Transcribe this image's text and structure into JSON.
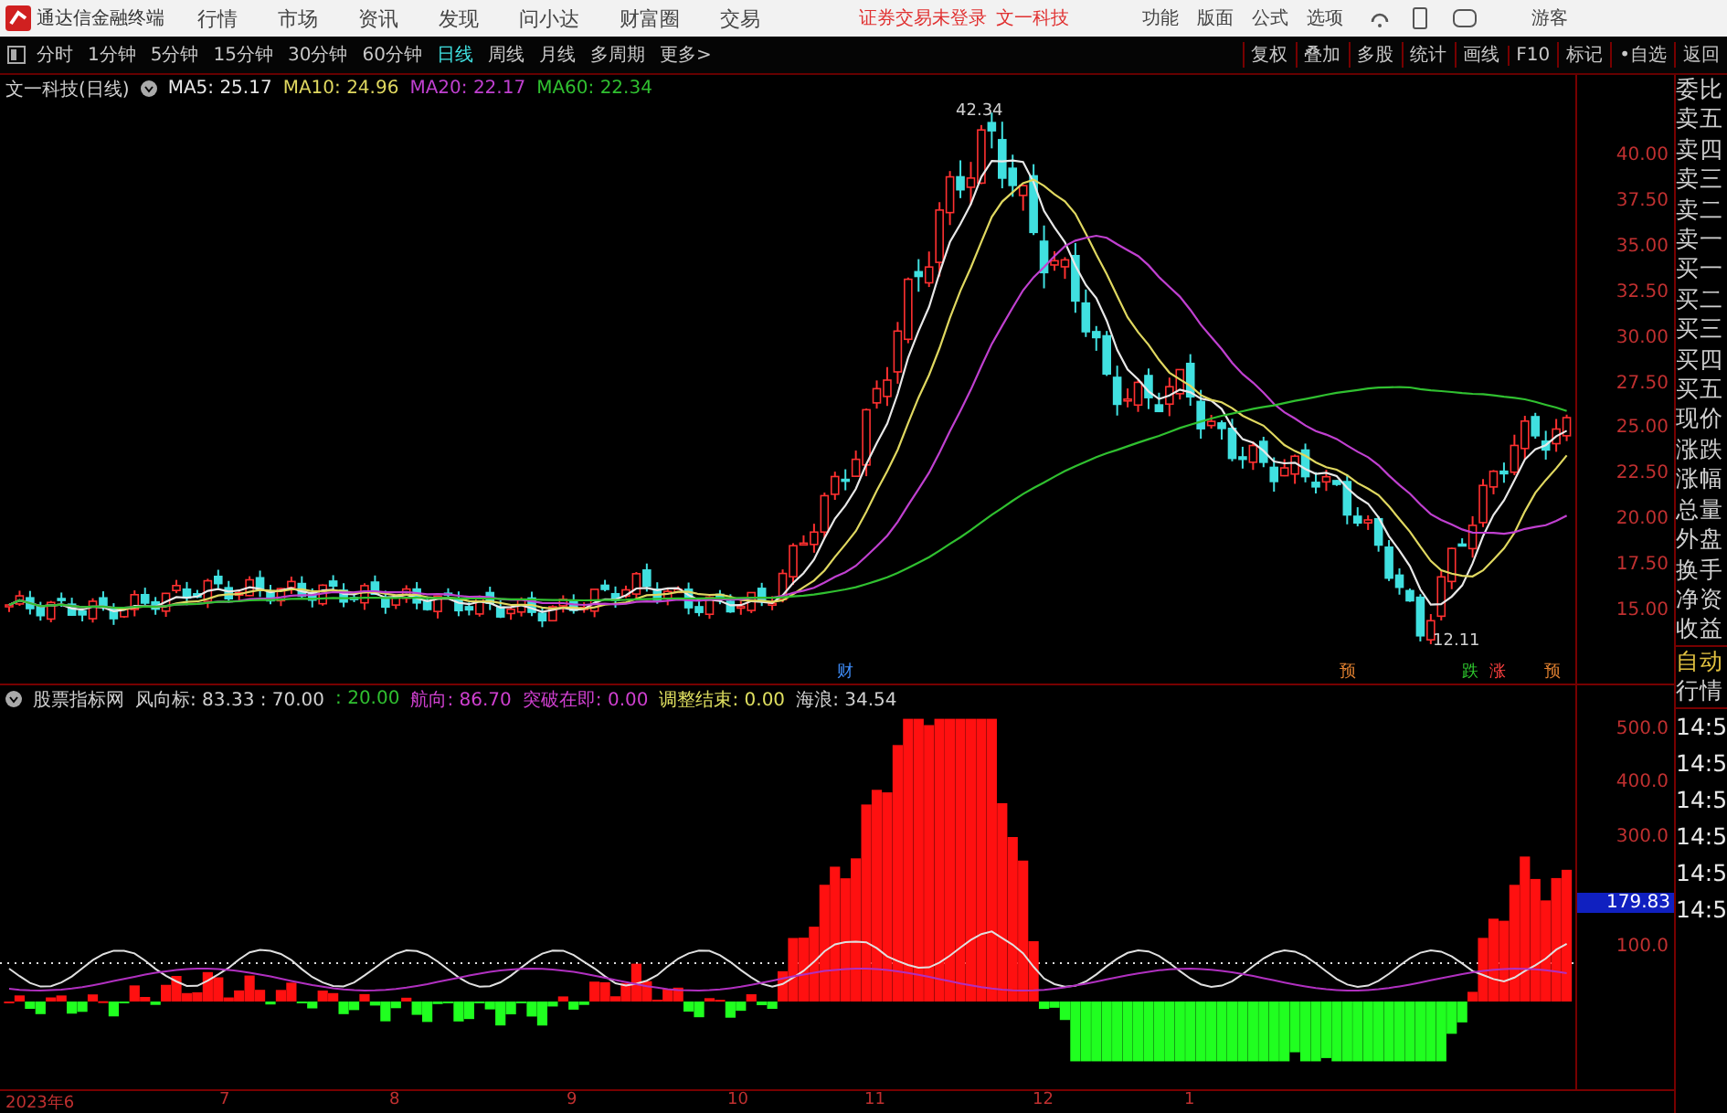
{
  "title_bar": {
    "app_title": "通达信金融终端",
    "menu": [
      "行情",
      "市场",
      "资讯",
      "发现",
      "问小达",
      "财富圈",
      "交易"
    ],
    "notice": "证券交易未登录",
    "stock": "文一科技",
    "tools": [
      "功能",
      "版面",
      "公式",
      "选项"
    ],
    "user": "游客"
  },
  "toolbar": {
    "periods": [
      {
        "label": "分时",
        "selected": false
      },
      {
        "label": "1分钟",
        "selected": false
      },
      {
        "label": "5分钟",
        "selected": false
      },
      {
        "label": "15分钟",
        "selected": false
      },
      {
        "label": "30分钟",
        "selected": false
      },
      {
        "label": "60分钟",
        "selected": false
      },
      {
        "label": "日线",
        "selected": true
      },
      {
        "label": "周线",
        "selected": false
      },
      {
        "label": "月线",
        "selected": false
      },
      {
        "label": "多周期",
        "selected": false
      },
      {
        "label": "更多>",
        "selected": false
      }
    ],
    "actions": [
      "复权",
      "叠加",
      "多股",
      "统计",
      "画线",
      "F10",
      "标记",
      "•自选",
      "返回"
    ]
  },
  "main_chart": {
    "title": "文一科技(日线)",
    "ma": [
      {
        "label": "MA5: 25.17",
        "color": "#e8e8e8"
      },
      {
        "label": "MA10: 24.96",
        "color": "#e0d860"
      },
      {
        "label": "MA20: 22.17",
        "color": "#c040d0"
      },
      {
        "label": "MA60: 22.34",
        "color": "#30c030"
      }
    ],
    "high_label": "42.34",
    "low_label": "12.11",
    "signals": [
      {
        "label": "财",
        "color": "#4090ff"
      },
      {
        "label": "预",
        "color": "#e08030"
      },
      {
        "label": "跌",
        "color": "#30d030"
      },
      {
        "label": "涨",
        "color": "#ff4040"
      },
      {
        "label": "预",
        "color": "#e08030"
      }
    ],
    "y_ticks": [
      "40.00",
      "37.50",
      "35.00",
      "32.50",
      "30.00",
      "27.50",
      "25.00",
      "22.50",
      "20.00",
      "17.50",
      "15.00"
    ]
  },
  "indicator": {
    "name": "股票指标网",
    "items": [
      {
        "label": "风向标: 83.33 : 70.00",
        "color": "#d0d0d0"
      },
      {
        "label": ": 20.00",
        "color": "#30c030"
      },
      {
        "label": "航向: 86.70",
        "color": "#d040d0"
      },
      {
        "label": "突破在即: 0.00",
        "color": "#d040d0"
      },
      {
        "label": "调整结束: 0.00",
        "color": "#e0e060"
      },
      {
        "label": "海浪: 34.54",
        "color": "#d0d0d0"
      }
    ],
    "y_ticks": [
      "500.0",
      "400.0",
      "300.0",
      "100.0"
    ],
    "current_value": "179.83"
  },
  "date_axis": [
    "2023年6",
    "7",
    "8",
    "9",
    "10",
    "11",
    "12",
    "1"
  ],
  "side_panel": {
    "quote_labels": [
      "委比",
      "卖五",
      "卖四",
      "卖三",
      "卖二",
      "卖一",
      "买一",
      "买二",
      "买三",
      "买四",
      "买五",
      "现价",
      "涨跌",
      "涨幅",
      "总量",
      "外盘",
      "换手",
      "净资",
      "收益"
    ],
    "mode": [
      "自动",
      "行情"
    ],
    "times": [
      "14:5",
      "14:5",
      "14:5",
      "14:5",
      "14:5",
      "14:5"
    ]
  }
}
